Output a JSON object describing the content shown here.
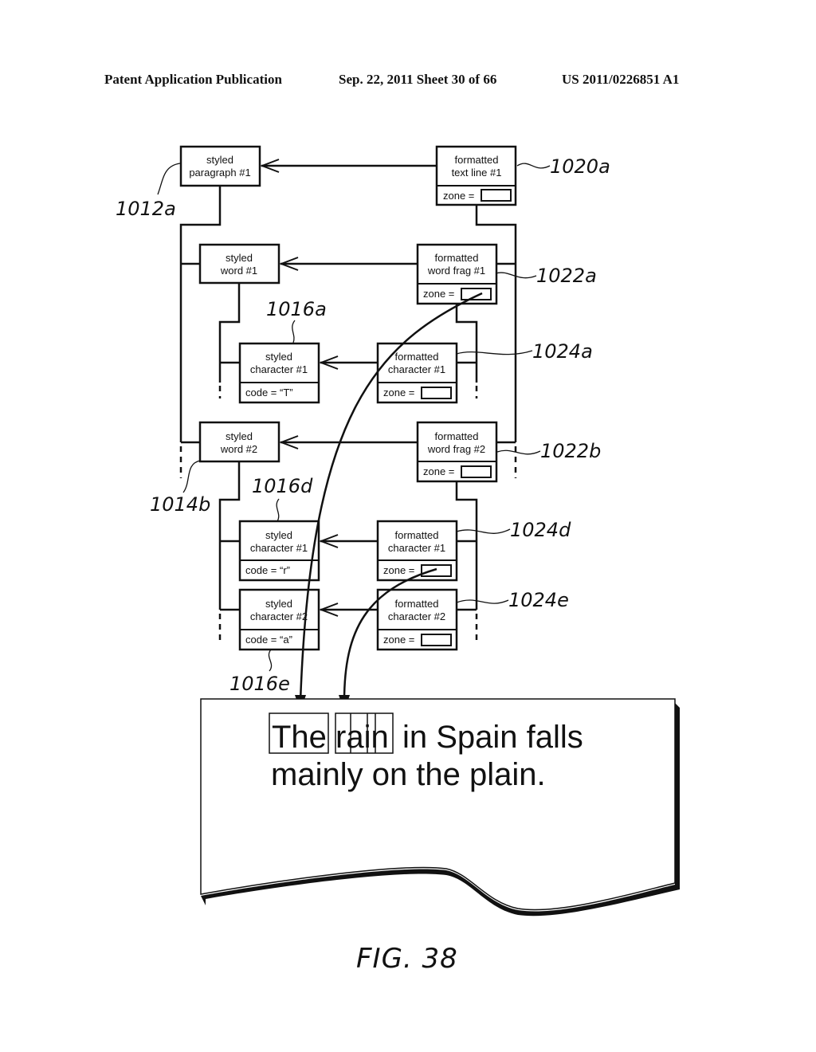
{
  "header": {
    "publication": "Patent Application Publication",
    "date_sheet": "Sep. 22, 2011   Sheet 30 of 66",
    "patent_number": "US 2011/0226851 A1"
  },
  "nodes": {
    "styled_paragraph": {
      "line1": "styled",
      "line2": "paragraph #1"
    },
    "formatted_text_line": {
      "line1": "formatted",
      "line2": "text line #1",
      "field": "zone ="
    },
    "styled_word_1": {
      "line1": "styled",
      "line2": "word #1"
    },
    "formatted_word_frag_1": {
      "line1": "formatted",
      "line2": "word frag #1",
      "field": "zone ="
    },
    "styled_char_1a": {
      "line1": "styled",
      "line2": "character #1",
      "field": "code = “T”"
    },
    "formatted_char_1a": {
      "line1": "formatted",
      "line2": "character #1",
      "field": "zone ="
    },
    "styled_word_2": {
      "line1": "styled",
      "line2": "word #2"
    },
    "formatted_word_frag_2": {
      "line1": "formatted",
      "line2": "word frag #2",
      "field": "zone ="
    },
    "styled_char_1d": {
      "line1": "styled",
      "line2": "character #1",
      "field": "code = “r”"
    },
    "formatted_char_1d": {
      "line1": "formatted",
      "line2": "character #1",
      "field": "zone ="
    },
    "styled_char_2e": {
      "line1": "styled",
      "line2": "character #2",
      "field": "code = “a”"
    },
    "formatted_char_2e": {
      "line1": "formatted",
      "line2": "character #2",
      "field": "zone ="
    }
  },
  "reference_labels": {
    "r1012a": "1012a",
    "r1020a": "1020a",
    "r1022a": "1022a",
    "r1016a": "1016a",
    "r1024a": "1024a",
    "r1022b": "1022b",
    "r1014b": "1014b",
    "r1016d": "1016d",
    "r1024d": "1024d",
    "r1024e": "1024e",
    "r1016e": "1016e"
  },
  "page": {
    "line1_words": [
      "The",
      "rain",
      "in Spain falls"
    ],
    "line2": "mainly on the plain."
  },
  "figure_label": "FIG. 38"
}
